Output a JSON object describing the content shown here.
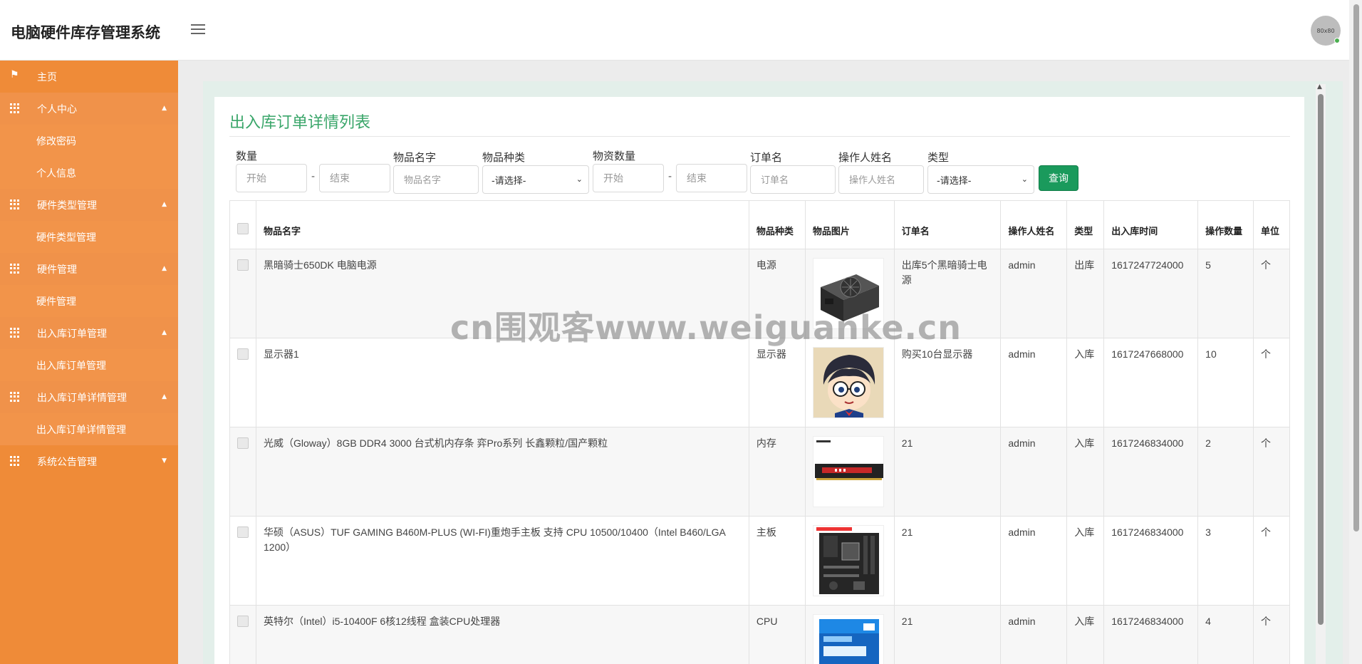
{
  "header": {
    "app_title": "电脑硬件库存管理系统",
    "avatar_text": "80x80"
  },
  "sidebar": {
    "home": "主页",
    "groups": [
      {
        "label": "个人中心",
        "children": [
          "修改密码",
          "个人信息"
        ]
      },
      {
        "label": "硬件类型管理",
        "children": [
          "硬件类型管理"
        ]
      },
      {
        "label": "硬件管理",
        "children": [
          "硬件管理"
        ]
      },
      {
        "label": "出入库订单管理",
        "children": [
          "出入库订单管理"
        ]
      },
      {
        "label": "出入库订单详情管理",
        "children": [
          "出入库订单详情管理"
        ]
      },
      {
        "label": "系统公告管理",
        "children": []
      }
    ]
  },
  "main": {
    "title": "出入库订单详情列表",
    "filters": {
      "qty_label": "数量",
      "qty_start_ph": "开始",
      "qty_end_ph": "结束",
      "name_label": "物品名字",
      "name_ph": "物品名字",
      "kind_label": "物品种类",
      "kind_value": "-请选择-",
      "stock_label": "物资数量",
      "stock_start_ph": "开始",
      "stock_end_ph": "结束",
      "order_label": "订单名",
      "order_ph": "订单名",
      "operator_label": "操作人姓名",
      "operator_ph": "操作人姓名",
      "type_label": "类型",
      "type_value": "-请选择-",
      "dash": "-",
      "query_button": "查询"
    },
    "table": {
      "headers": [
        "物品名字",
        "物品种类",
        "物品图片",
        "订单名",
        "操作人姓名",
        "类型",
        "出入库时间",
        "操作数量",
        "单位"
      ],
      "rows": [
        {
          "name": "黑暗骑士650DK 电脑电源",
          "kind": "电源",
          "image": "psu",
          "order": "出库5个黑暗骑士电源",
          "operator": "admin",
          "type": "出库",
          "time": "1617247724000",
          "qty": "5",
          "unit": "个"
        },
        {
          "name": "显示器1",
          "kind": "显示器",
          "image": "cartoon",
          "order": "购买10台显示器",
          "operator": "admin",
          "type": "入库",
          "time": "1617247668000",
          "qty": "10",
          "unit": "个"
        },
        {
          "name": "光威（Gloway）8GB DDR4 3000 台式机内存条 弈Pro系列 长鑫颗粒/国产颗粒",
          "kind": "内存",
          "image": "ram",
          "order": "21",
          "operator": "admin",
          "type": "入库",
          "time": "1617246834000",
          "qty": "2",
          "unit": "个"
        },
        {
          "name": "华硕（ASUS）TUF GAMING B460M-PLUS (WI-FI)重炮手主板 支持 CPU 10500/10400（Intel B460/LGA 1200）",
          "kind": "主板",
          "image": "motherboard",
          "order": "21",
          "operator": "admin",
          "type": "入库",
          "time": "1617246834000",
          "qty": "3",
          "unit": "个"
        },
        {
          "name": "英特尔（Intel）i5-10400F 6核12线程 盒装CPU处理器",
          "kind": "CPU",
          "image": "cpu",
          "order": "21",
          "operator": "admin",
          "type": "入库",
          "time": "1617246834000",
          "qty": "4",
          "unit": "个"
        }
      ]
    }
  },
  "watermark": "cn围观客www.weiguanke.cn",
  "icons": {
    "menu": "hamburger-icon",
    "home": "flag-icon",
    "group": "grid-icon",
    "caret": "chevron-icon",
    "select": "chevron-down-icon"
  }
}
